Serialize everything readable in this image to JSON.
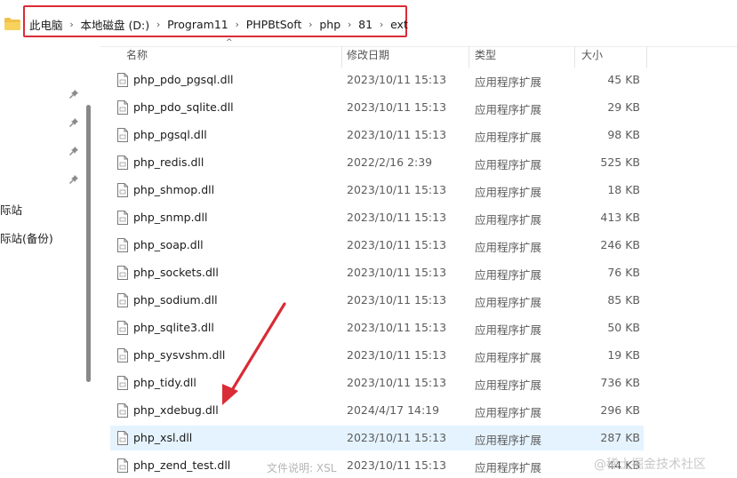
{
  "address_bar": {
    "crumbs": [
      "此电脑",
      "本地磁盘 (D:)",
      "Program11",
      "PHPBtSoft",
      "php",
      "81",
      "ext"
    ],
    "highlight_color": "#d92c36"
  },
  "nav": {
    "items": [
      "际站",
      "际站(备份)"
    ]
  },
  "columns": {
    "name": "名称",
    "date": "修改日期",
    "type": "类型",
    "size": "大小"
  },
  "files": [
    {
      "name": "php_pdo_pgsql.dll",
      "date": "2023/10/11 15:13",
      "type": "应用程序扩展",
      "size": "45 KB"
    },
    {
      "name": "php_pdo_sqlite.dll",
      "date": "2023/10/11 15:13",
      "type": "应用程序扩展",
      "size": "29 KB"
    },
    {
      "name": "php_pgsql.dll",
      "date": "2023/10/11 15:13",
      "type": "应用程序扩展",
      "size": "98 KB"
    },
    {
      "name": "php_redis.dll",
      "date": "2022/2/16 2:39",
      "type": "应用程序扩展",
      "size": "525 KB"
    },
    {
      "name": "php_shmop.dll",
      "date": "2023/10/11 15:13",
      "type": "应用程序扩展",
      "size": "18 KB"
    },
    {
      "name": "php_snmp.dll",
      "date": "2023/10/11 15:13",
      "type": "应用程序扩展",
      "size": "413 KB"
    },
    {
      "name": "php_soap.dll",
      "date": "2023/10/11 15:13",
      "type": "应用程序扩展",
      "size": "246 KB"
    },
    {
      "name": "php_sockets.dll",
      "date": "2023/10/11 15:13",
      "type": "应用程序扩展",
      "size": "76 KB"
    },
    {
      "name": "php_sodium.dll",
      "date": "2023/10/11 15:13",
      "type": "应用程序扩展",
      "size": "85 KB"
    },
    {
      "name": "php_sqlite3.dll",
      "date": "2023/10/11 15:13",
      "type": "应用程序扩展",
      "size": "50 KB"
    },
    {
      "name": "php_sysvshm.dll",
      "date": "2023/10/11 15:13",
      "type": "应用程序扩展",
      "size": "19 KB"
    },
    {
      "name": "php_tidy.dll",
      "date": "2023/10/11 15:13",
      "type": "应用程序扩展",
      "size": "736 KB"
    },
    {
      "name": "php_xdebug.dll",
      "date": "2024/4/17 14:19",
      "type": "应用程序扩展",
      "size": "296 KB"
    },
    {
      "name": "php_xsl.dll",
      "date": "2023/10/11 15:13",
      "type": "应用程序扩展",
      "size": "287 KB",
      "selected": true
    },
    {
      "name": "php_zend_test.dll",
      "date": "2023/10/11 15:13",
      "type": "应用程序扩展",
      "size": "44 KB"
    }
  ],
  "tooltip": "文件说明: XSL",
  "watermark": "@稀土掘金技术社区",
  "icons": {
    "folder": "folder-icon",
    "file": "dll-file-icon",
    "pin": "pin-icon",
    "arrow": "red-arrow-annotation"
  },
  "colors": {
    "selected_row": "#e5f3ff",
    "annotation_arrow": "#d92c36"
  }
}
